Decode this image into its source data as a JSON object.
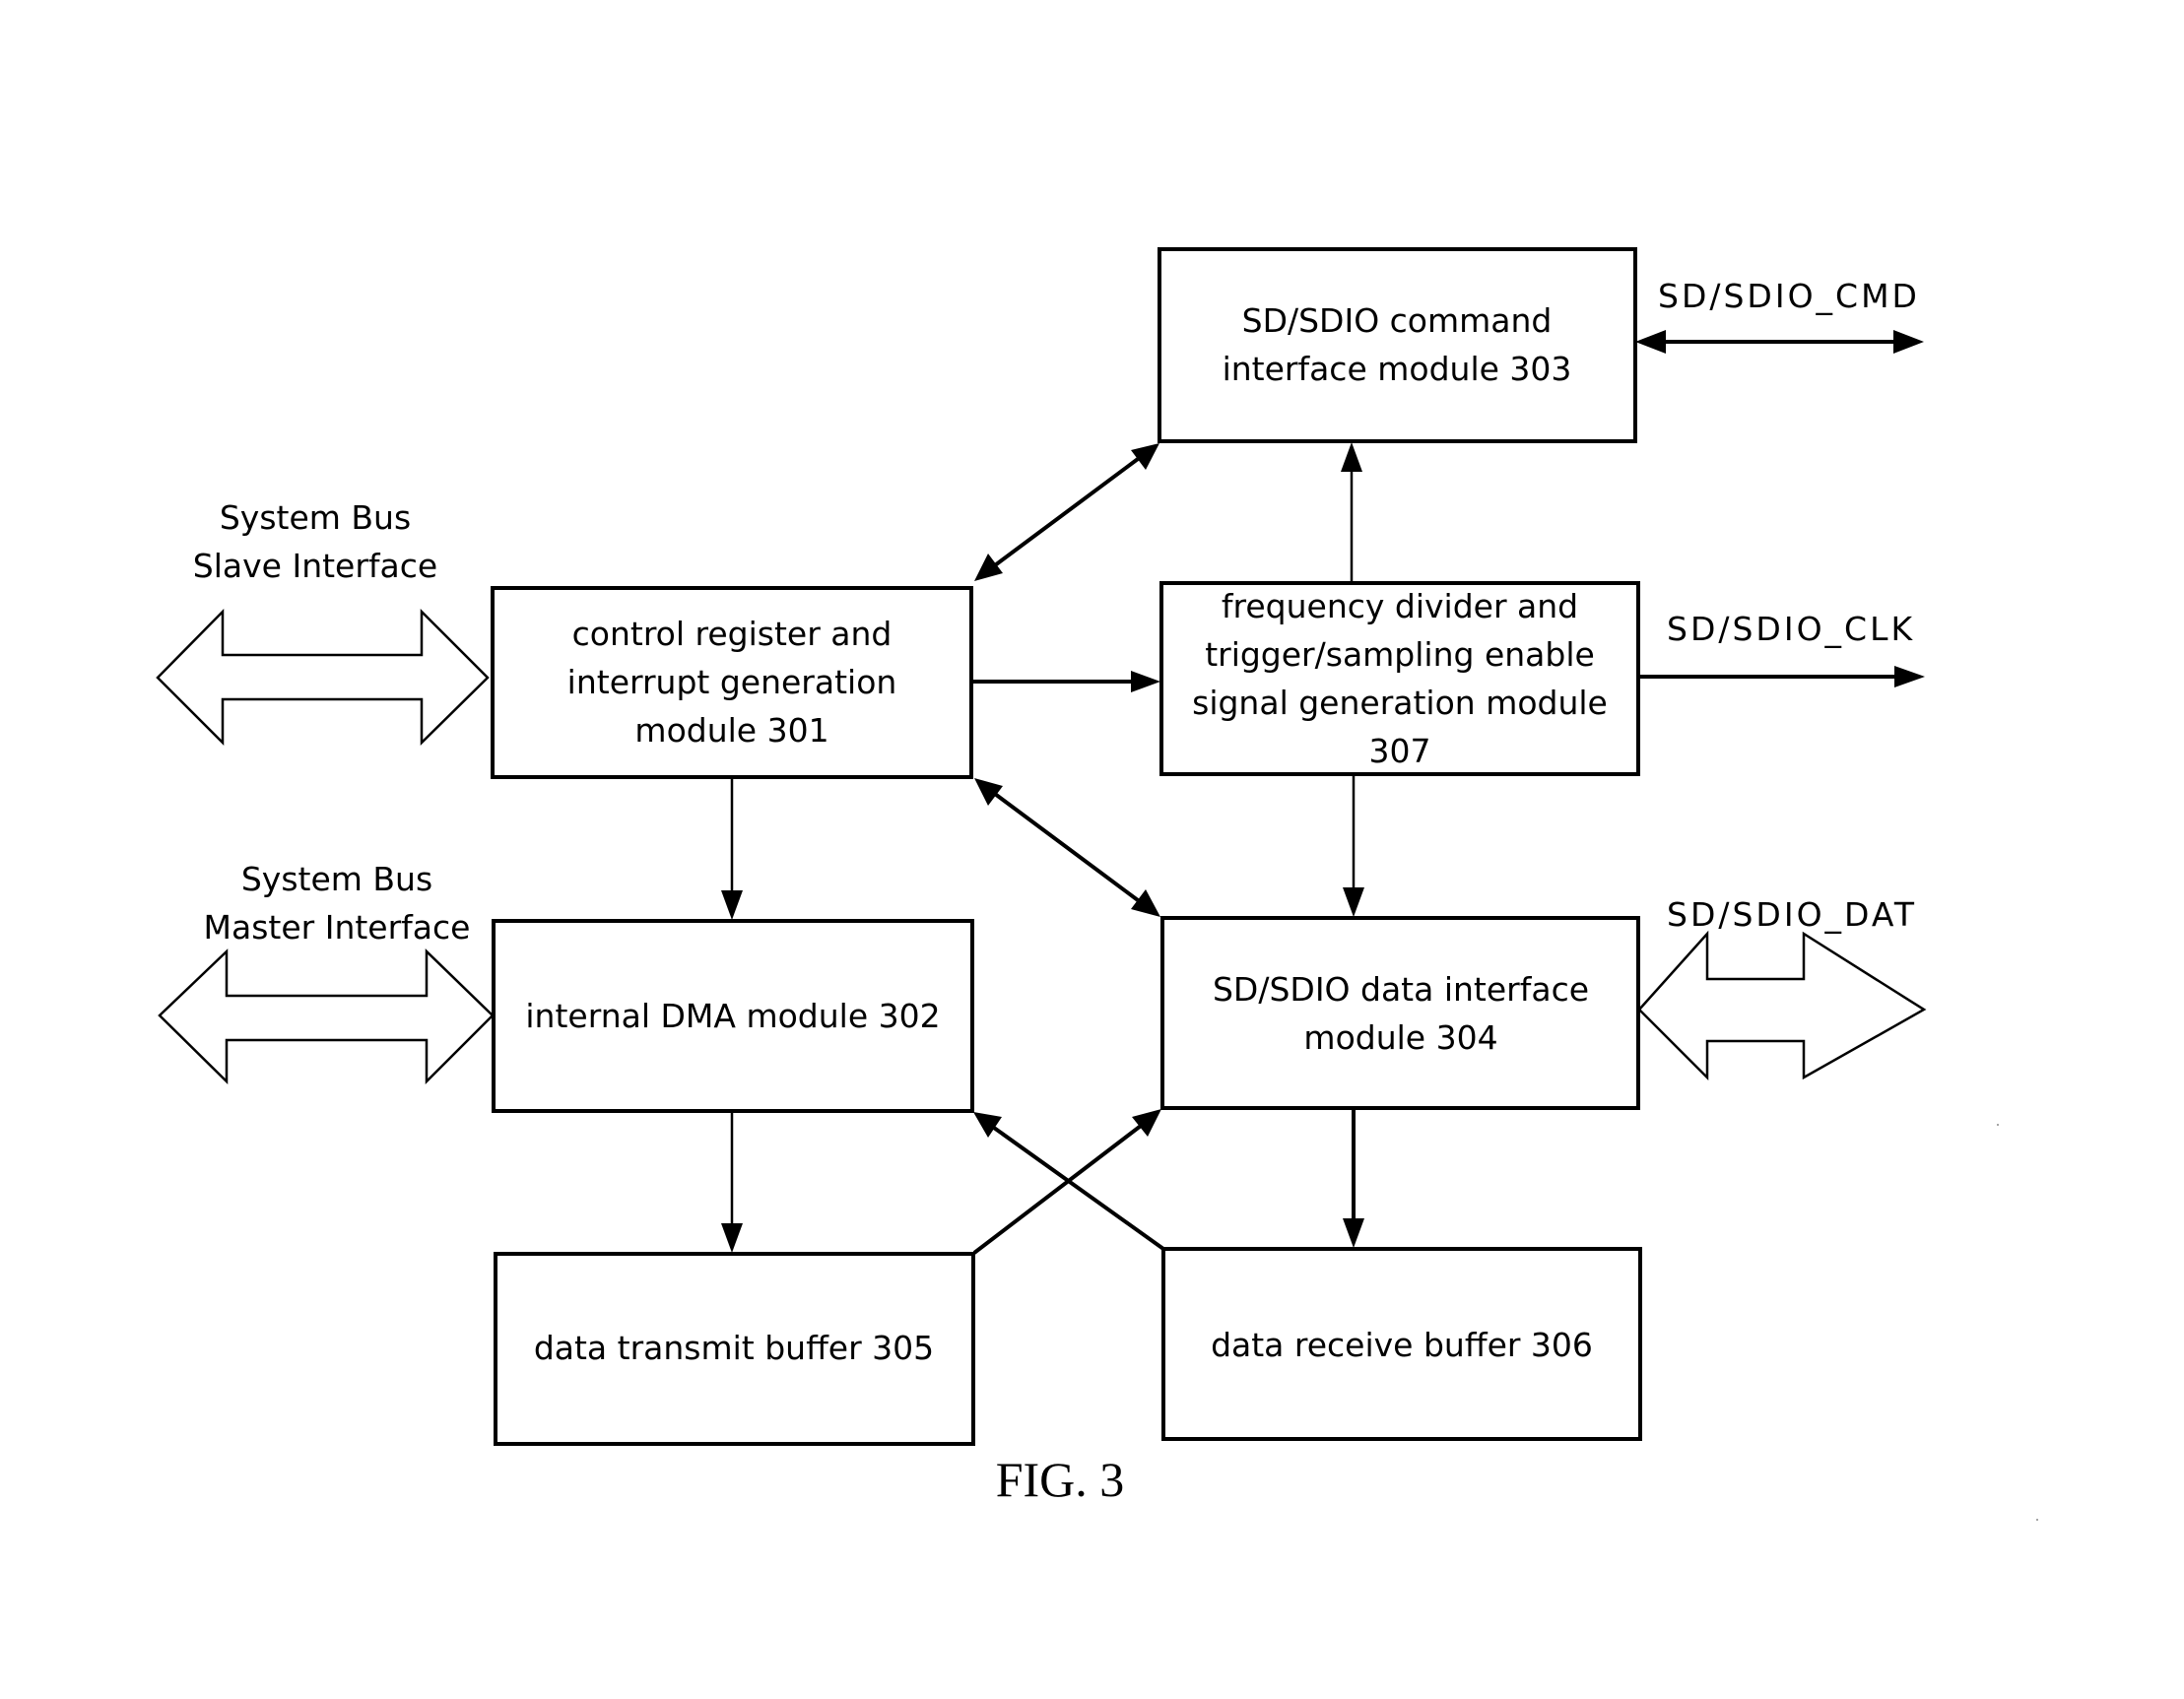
{
  "figure": {
    "caption": "FIG. 3"
  },
  "modules": {
    "m301": {
      "lines": [
        "control  register and",
        "interrupt generation",
        "module 301"
      ]
    },
    "m302": {
      "lines": [
        "internal DMA  module 302"
      ]
    },
    "m303": {
      "lines": [
        "SD/SDIO command",
        "interface module 303"
      ]
    },
    "m304": {
      "lines": [
        "SD/SDIO data interface",
        "module 304"
      ]
    },
    "m305": {
      "lines": [
        "data transmit buffer 305"
      ]
    },
    "m306": {
      "lines": [
        "data receive buffer 306"
      ]
    },
    "m307": {
      "lines": [
        "frequency divider and",
        "trigger/sampling enable",
        "signal generation module",
        "307"
      ]
    }
  },
  "interfaces": {
    "slave": {
      "lines": [
        "System Bus",
        "Slave Interface"
      ]
    },
    "master": {
      "lines": [
        "System Bus",
        "Master Interface"
      ]
    }
  },
  "signals": {
    "cmd": "SD/SDIO_CMD",
    "clk": "SD/SDIO_CLK",
    "dat": "SD/SDIO_DAT"
  },
  "connections": [
    {
      "from": "module 301",
      "to": "module 303",
      "direction": "bidirectional"
    },
    {
      "from": "module 301",
      "to": "module 307",
      "direction": "forward"
    },
    {
      "from": "module 301",
      "to": "module 304",
      "direction": "bidirectional"
    },
    {
      "from": "module 301",
      "to": "module 302",
      "direction": "forward"
    },
    {
      "from": "module 307",
      "to": "module 303",
      "direction": "forward"
    },
    {
      "from": "module 307",
      "to": "module 304",
      "direction": "forward"
    },
    {
      "from": "module 302",
      "to": "module 305",
      "direction": "forward"
    },
    {
      "from": "module 305",
      "to": "module 304",
      "direction": "forward"
    },
    {
      "from": "module 304",
      "to": "module 306",
      "direction": "forward"
    },
    {
      "from": "module 306",
      "to": "module 302",
      "direction": "forward"
    },
    {
      "from": "module 303",
      "to": "SD/SDIO_CMD",
      "direction": "bidirectional"
    },
    {
      "from": "module 307",
      "to": "SD/SDIO_CLK",
      "direction": "forward"
    },
    {
      "from": "module 304",
      "to": "SD/SDIO_DAT",
      "direction": "bidirectional-bus"
    },
    {
      "from": "System Bus Slave Interface",
      "to": "module 301",
      "direction": "bidirectional-bus"
    },
    {
      "from": "System Bus Master Interface",
      "to": "module 302",
      "direction": "bidirectional-bus"
    }
  ]
}
